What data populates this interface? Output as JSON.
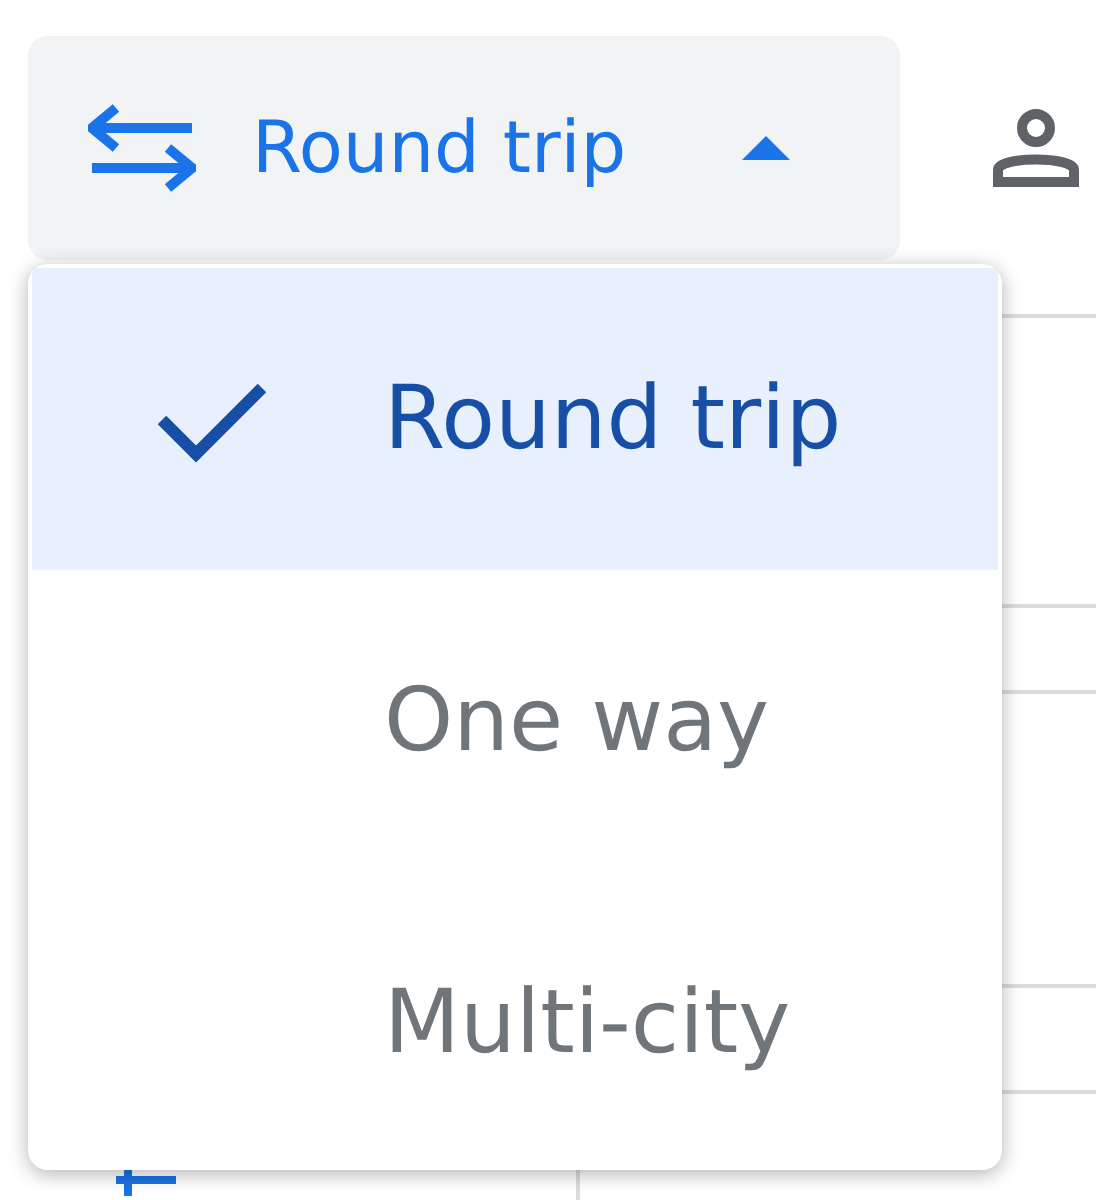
{
  "trip_type_button": {
    "label": "Round trip",
    "expanded": true
  },
  "trip_type_menu": [
    {
      "label": "Round trip",
      "selected": true
    },
    {
      "label": "One way",
      "selected": false
    },
    {
      "label": "Multi-city",
      "selected": false
    }
  ]
}
